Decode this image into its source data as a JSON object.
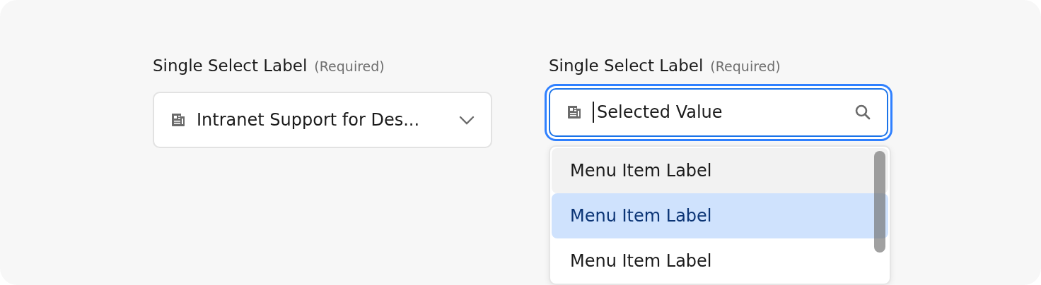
{
  "fields": [
    {
      "label": "Single Select Label",
      "hint": "(Required)",
      "kind": "select",
      "value": "Intranet Support for Des...",
      "focused": false
    },
    {
      "label": "Single Select Label",
      "hint": "(Required)",
      "kind": "search",
      "value": "Selected Value",
      "focused": true,
      "menu": [
        {
          "label": "Menu Item Label",
          "hovered": true,
          "selected": false
        },
        {
          "label": "Menu Item Label",
          "hovered": false,
          "selected": true
        },
        {
          "label": "Menu Item Label",
          "hovered": false,
          "selected": false
        }
      ]
    }
  ]
}
